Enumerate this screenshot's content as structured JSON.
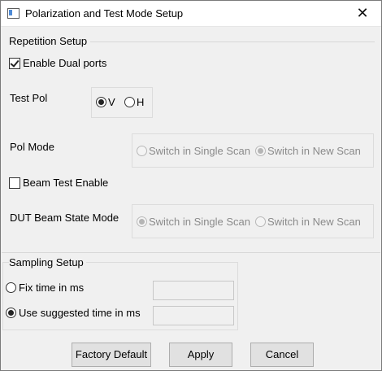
{
  "window": {
    "title": "Polarization and Test Mode Setup",
    "close_glyph": "✕"
  },
  "repetition": {
    "title": "Repetition Setup",
    "enable_dual_ports": {
      "label": "Enable Dual ports",
      "checked": true
    },
    "test_pol": {
      "label": "Test Pol",
      "options": [
        "V",
        "H"
      ],
      "selected": "V"
    },
    "pol_mode": {
      "label": "Pol Mode",
      "options": [
        "Switch in Single Scan",
        "Switch in New Scan"
      ],
      "selected": "Switch in New Scan",
      "enabled": false
    },
    "beam_test_enable": {
      "label": "Beam Test Enable",
      "checked": false
    },
    "dut_beam_state_mode": {
      "label": "DUT Beam State Mode",
      "options": [
        "Switch in Single Scan",
        "Switch in New Scan"
      ],
      "selected": "Switch in Single Scan",
      "enabled": false
    }
  },
  "sampling": {
    "title": "Sampling Setup",
    "fix_time": {
      "label": "Fix time in ms",
      "selected": false,
      "value": ""
    },
    "suggested_time": {
      "label": "Use suggested time in ms",
      "selected": true,
      "value": ""
    }
  },
  "buttons": {
    "factory_default": "Factory Default",
    "apply": "Apply",
    "cancel": "Cancel"
  }
}
